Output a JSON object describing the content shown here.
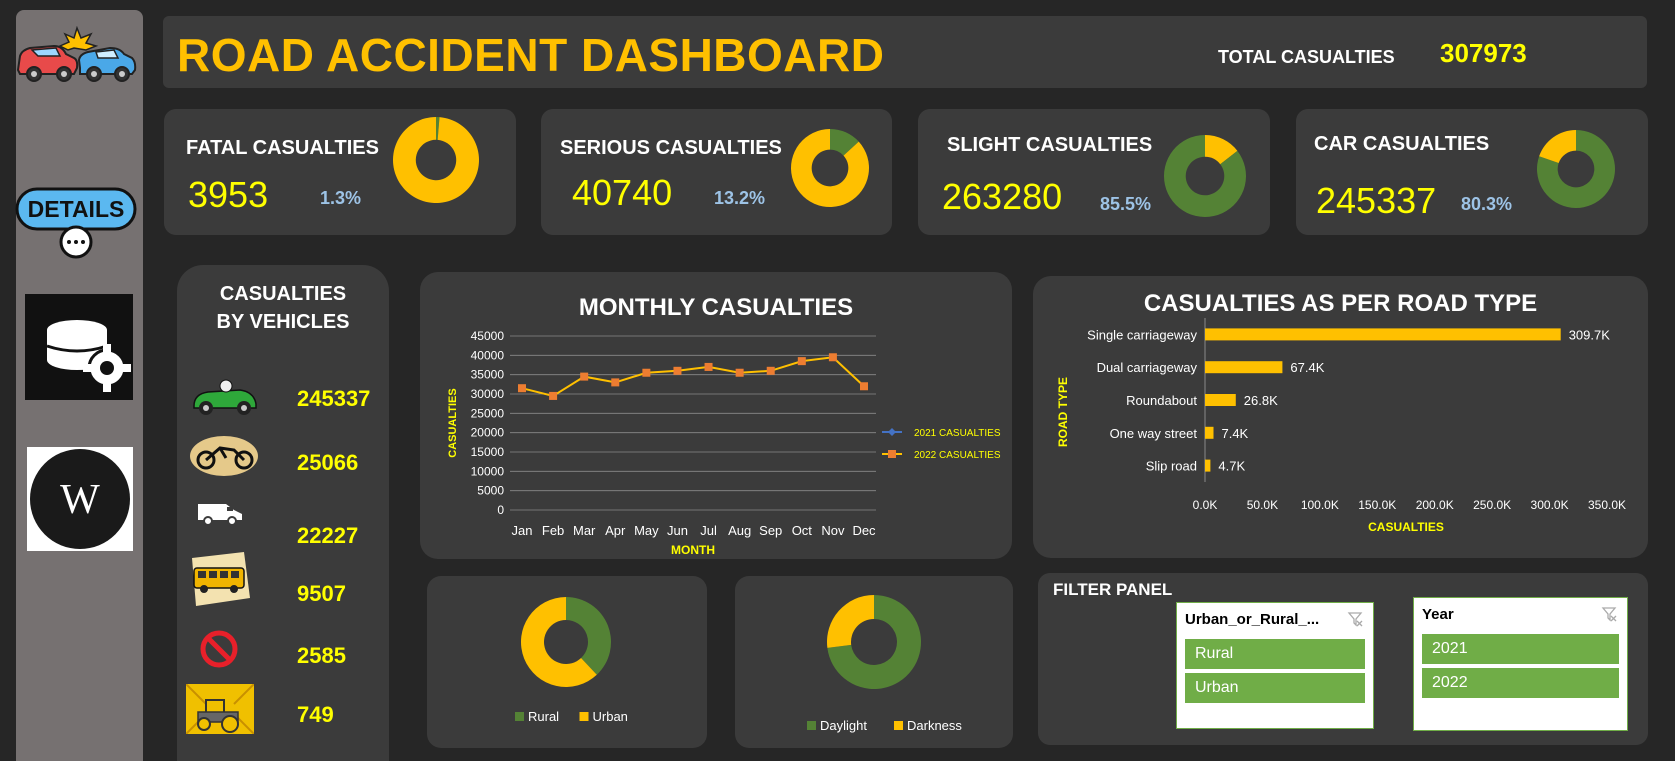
{
  "header": {
    "title": "ROAD ACCIDENT DASHBOARD",
    "total_label": "TOTAL CASUALTIES",
    "total_value": "307973"
  },
  "sidebar": {
    "details_label": "DETAILS",
    "wiki_letter": "W"
  },
  "kpis": [
    {
      "label": "FATAL CASUALTIES",
      "value": "3953",
      "pct": "1.3%",
      "share": 0.013
    },
    {
      "label": "SERIOUS CASUALTIES",
      "value": "40740",
      "pct": "13.2%",
      "share": 0.132
    },
    {
      "label": "SLIGHT CASUALTIES",
      "value": "263280",
      "pct": "85.5%",
      "share": 0.855
    },
    {
      "label": "CAR CASUALTIES",
      "value": "245337",
      "pct": "80.3%",
      "share": 0.803
    }
  ],
  "vehicles": {
    "title_line1": "CASUALTIES",
    "title_line2": "BY VEHICLES",
    "items": [
      {
        "icon": "car-icon",
        "value": "245337"
      },
      {
        "icon": "motorcycle-icon",
        "value": "25066"
      },
      {
        "icon": "van-icon",
        "value": "22227"
      },
      {
        "icon": "bus-icon",
        "value": "9507"
      },
      {
        "icon": "no-entry-icon",
        "value": "2585"
      },
      {
        "icon": "tractor-icon",
        "value": "749"
      }
    ]
  },
  "colors": {
    "accent": "#ffc000",
    "green": "#548235",
    "blue": "#4472c4",
    "orange": "#ed7d31",
    "kpi_value": "#ffff00",
    "pct": "#9dc3e6"
  },
  "chart_data": [
    {
      "type": "line",
      "title": "MONTHLY CASUALTIES",
      "xlabel": "MONTH",
      "ylabel": "CASUALTIES",
      "categories": [
        "Jan",
        "Feb",
        "Mar",
        "Apr",
        "May",
        "Jun",
        "Jul",
        "Aug",
        "Sep",
        "Oct",
        "Nov",
        "Dec"
      ],
      "yticks": [
        "0",
        "5000",
        "10000",
        "15000",
        "20000",
        "25000",
        "30000",
        "35000",
        "40000",
        "45000"
      ],
      "ylim": [
        0,
        45000
      ],
      "grid": true,
      "legend_position": "right",
      "series": [
        {
          "name": "2021 CASUALTIES",
          "values": [],
          "color": "#4472c4"
        },
        {
          "name": "2022 CASUALTIES",
          "values": [
            31500,
            29500,
            34500,
            33000,
            35500,
            36000,
            37000,
            35500,
            36000,
            38500,
            39500,
            32000
          ],
          "color": "#ffc000"
        }
      ]
    },
    {
      "type": "bar",
      "orientation": "horizontal",
      "title": "CASUALTIES AS PER ROAD TYPE",
      "xlabel": "CASUALTIES",
      "ylabel": "ROAD TYPE",
      "categories": [
        "Single carriageway",
        "Dual carriageway",
        "Roundabout",
        "One way street",
        "Slip road"
      ],
      "values": [
        309700,
        67400,
        26800,
        7400,
        4700
      ],
      "labels": [
        "309.7K",
        "67.4K",
        "26.8K",
        "7.4K",
        "4.7K"
      ],
      "xticks": [
        "0.0K",
        "50.0K",
        "100.0K",
        "150.0K",
        "200.0K",
        "250.0K",
        "300.0K",
        "350.0K"
      ],
      "xlim": [
        0,
        350000
      ],
      "color": "#ffc000"
    },
    {
      "type": "pie",
      "categories": [
        "Rural",
        "Urban"
      ],
      "values": [
        38,
        62
      ],
      "colors": [
        "#548235",
        "#ffc000"
      ],
      "legend_position": "bottom"
    },
    {
      "type": "pie",
      "categories": [
        "Daylight",
        "Darkness"
      ],
      "values": [
        73,
        27
      ],
      "colors": [
        "#548235",
        "#ffc000"
      ],
      "legend_position": "bottom"
    }
  ],
  "filter_panel": {
    "title": "FILTER PANEL",
    "slicer1": {
      "title": "Urban_or_Rural_...",
      "items": [
        "Rural",
        "Urban"
      ]
    },
    "slicer2": {
      "title": "Year",
      "items": [
        "2021",
        "2022"
      ]
    }
  }
}
